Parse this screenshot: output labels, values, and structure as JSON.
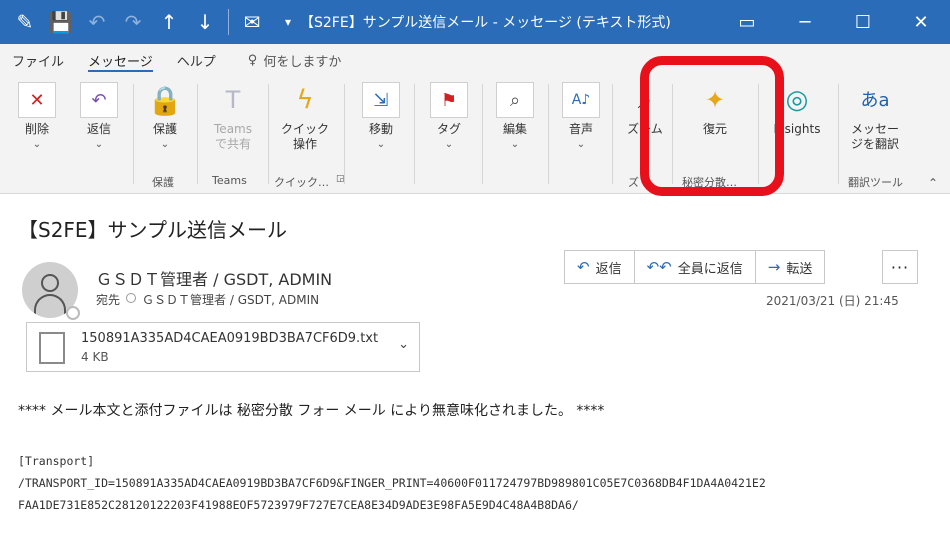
{
  "window": {
    "title": "【S2FE】サンプル送信メール - メッセージ (テキスト形式)"
  },
  "menu": {
    "tabs": [
      "ファイル",
      "メッセージ",
      "ヘルプ"
    ],
    "active_tab": "メッセージ",
    "tell_me": "何をしますか"
  },
  "ribbon": {
    "buttons": {
      "delete": "削除",
      "reply": "返信",
      "protect": "保護",
      "teams_share_1": "Teams",
      "teams_share_2": "で共有",
      "quick_steps_1": "クイック",
      "quick_steps_2": "操作",
      "move": "移動",
      "tags": "タグ",
      "edit": "編集",
      "voice": "音声",
      "zoom": "ズーム",
      "restore": "復元",
      "insights": "Insights",
      "translate_1": "メッセー",
      "translate_2": "ジを翻訳"
    },
    "groups": {
      "protect": "保護",
      "teams": "Teams",
      "quick": "クイック…",
      "zoom": "ズ",
      "secret": "秘密分散…",
      "translate": "翻訳ツール"
    }
  },
  "message": {
    "subject": "【S2FE】サンプル送信メール",
    "sender": "ＧＳＤＴ管理者 / GSDT, ADMIN",
    "to_label": "宛先",
    "to": "ＧＳＤＴ管理者 / GSDT, ADMIN",
    "datetime": "2021/03/21 (日) 21:45",
    "actions": {
      "reply": "返信",
      "reply_all": "全員に返信",
      "forward": "転送",
      "more": "···"
    },
    "attachment": {
      "name": "150891A335AD4CAEA0919BD3BA7CF6D9.txt",
      "size": "4 KB"
    },
    "body_notice": "**** メール本文と添付ファイルは 秘密分散 フォー メール により無意味化されました。 ****",
    "transport_header": "[Transport]",
    "transport_line1": "/TRANSPORT_ID=150891A335AD4CAEA0919BD3BA7CF6D9&FINGER_PRINT=40600F011724797BD989801C05E7C0368DB4F1DA4A0421E2",
    "transport_line2": "FAA1DE731E852C28120122203F41988EOF5723979F727E7CEA8E34D9ADE3E98FA5E9D4C48A4B8DA6/"
  },
  "colors": {
    "titlebar": "#2b6cb8",
    "highlight": "#e8101a",
    "accent": "#2b6cb8"
  }
}
